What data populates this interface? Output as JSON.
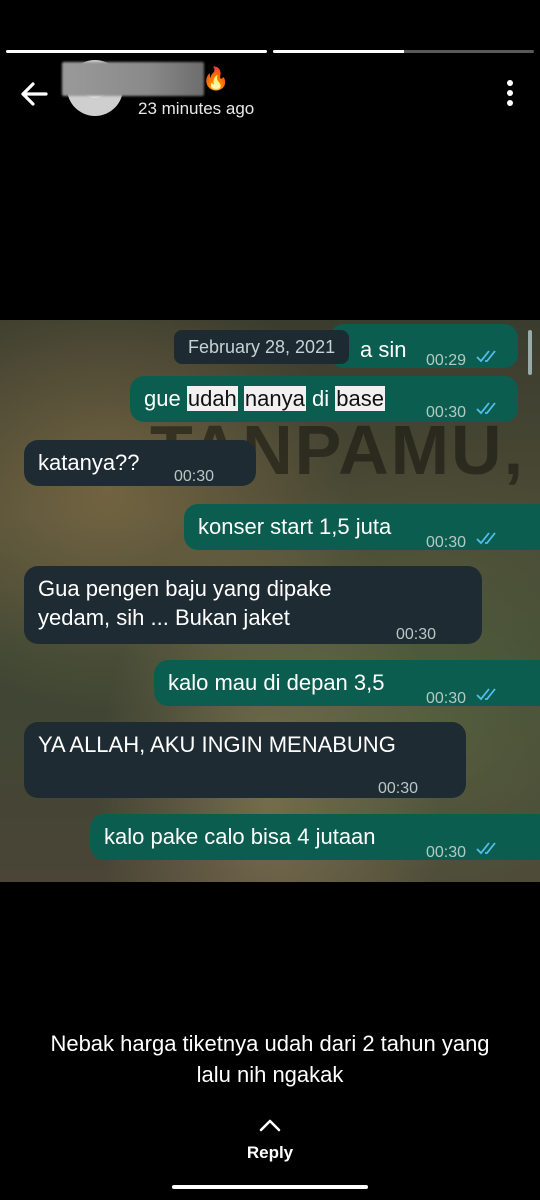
{
  "status": {
    "time_ago": "23 minutes ago",
    "emoji": "🔥",
    "progress": [
      1.0,
      0.5
    ]
  },
  "chat": {
    "date": "February 28, 2021",
    "messages": [
      {
        "dir": "out",
        "text": "a sin",
        "time": "00:29"
      },
      {
        "dir": "out",
        "parts": [
          "gue",
          "udah",
          "nanya",
          "di",
          "base"
        ],
        "time": "00:30"
      },
      {
        "dir": "in",
        "text": "katanya??",
        "time": "00:30"
      },
      {
        "dir": "out",
        "text": "konser start 1,5 juta",
        "time": "00:30"
      },
      {
        "dir": "in",
        "lines": [
          "Gua pengen baju yang dipake",
          "yedam, sih ... Bukan jaket"
        ],
        "time": "00:30"
      },
      {
        "dir": "out",
        "text": "kalo mau di depan 3,5",
        "time": "00:30"
      },
      {
        "dir": "in",
        "text": "YA ALLAH, AKU INGIN MENABUNG",
        "time": "00:30"
      },
      {
        "dir": "out",
        "text": "kalo pake calo bisa 4 jutaan",
        "time": "00:30"
      }
    ],
    "watermark": "TANPAMU,"
  },
  "caption": {
    "line1": "Nebak harga tiketnya udah dari 2 tahun yang",
    "line2": "lalu nih ngakak"
  },
  "reply_label": "Reply",
  "icons": {
    "back": "arrow-left-icon",
    "more": "more-vertical-icon",
    "reply": "chevron-up-icon",
    "ticks": "double-check-icon"
  },
  "colors": {
    "outgoing": "#0b5e4f",
    "incoming": "#1f2b33",
    "tick": "#53bdeb"
  }
}
